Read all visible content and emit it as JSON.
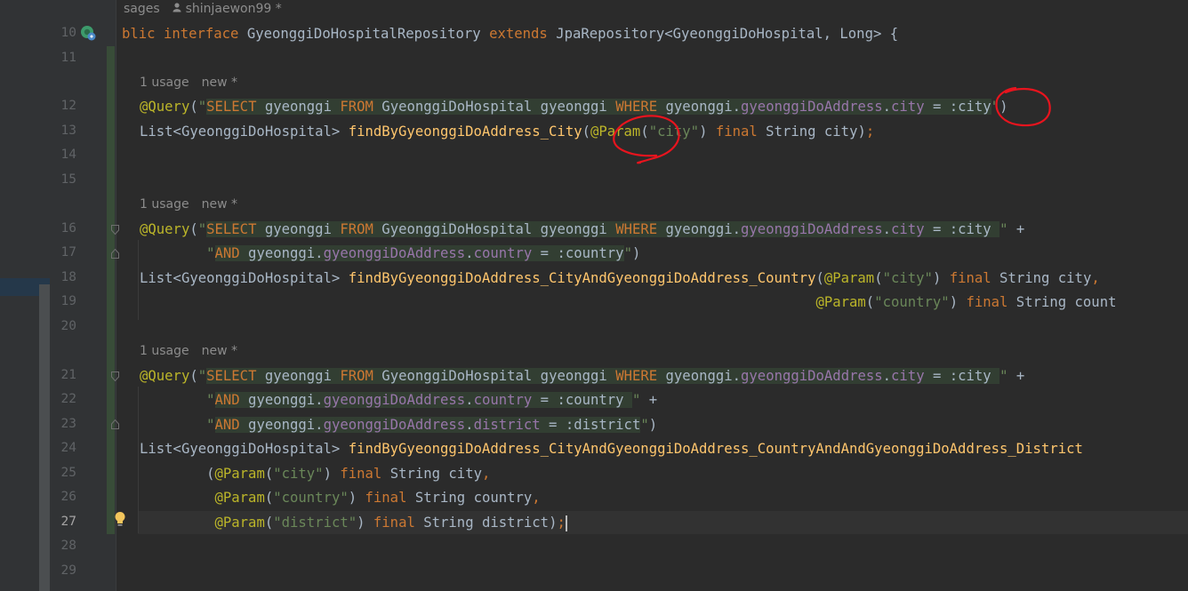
{
  "editor": {
    "top_hint": {
      "usages": "sages",
      "author": "shinjaewon99 *"
    },
    "current_line": "27",
    "line_numbers": [
      "10",
      "11",
      "12",
      "13",
      "14",
      "15",
      "16",
      "17",
      "18",
      "19",
      "20",
      "21",
      "22",
      "23",
      "24",
      "25",
      "26",
      "27",
      "28",
      "29"
    ],
    "usage_hints": [
      {
        "usage": "1 usage",
        "status": "new *"
      },
      {
        "usage": "1 usage",
        "status": "new *"
      },
      {
        "usage": "1 usage",
        "status": "new *"
      }
    ],
    "code": {
      "l10": {
        "kw1": "blic interface ",
        "name": "GyeonggiDoHospitalRepository ",
        "kw2": "extends ",
        "rest": "JpaRepository<GyeonggiDoHospital, Long> {"
      },
      "l12": {
        "ann": "@Query",
        "open": "(",
        "q": "\"",
        "sel": "SELECT",
        "t1": " gyeonggi ",
        "from": "FROM",
        "t2": " GyeonggiDoHospital gyeonggi ",
        "where": "WHERE",
        "t3": " gyeonggi.",
        "fld": "gyeonggiDoAddress",
        "dot": ".",
        "fld2": "city",
        "t4": " = :city",
        "q2": "\"",
        "close": ")"
      },
      "l13": {
        "t1": "List<GyeonggiDoHospital> ",
        "method": "findByGyeonggiDoAddress_City",
        "p1": "(",
        "ann": "@Param",
        "p2": "(",
        "str": "\"city\"",
        "p3": ") ",
        "kw": "final",
        "t2": " String city)",
        "semi": ";"
      },
      "l16": {
        "ann": "@Query",
        "open": "(",
        "q": "\"",
        "sel": "SELECT",
        "t1": " gyeonggi ",
        "from": "FROM",
        "t2": " GyeonggiDoHospital gyeonggi ",
        "where": "WHERE",
        "t3": " gyeonggi.",
        "fld": "gyeonggiDoAddress",
        "dot": ".",
        "fld2": "city",
        "t4": " = :city ",
        "q2": "\"",
        "plus": " +"
      },
      "l17": {
        "indent": "        ",
        "q": "\"",
        "and": "AND",
        "t1": " gyeonggi.",
        "fld": "gyeonggiDoAddress",
        "dot": ".",
        "fld2": "country",
        "t2": " = :country",
        "q2": "\"",
        "close": ")"
      },
      "l18": {
        "t1": "List<GyeonggiDoHospital> ",
        "method": "findByGyeonggiDoAddress_CityAndGyeonggiDoAddress_Country",
        "p1": "(",
        "ann": "@Param",
        "p2": "(",
        "str": "\"city\"",
        "p3": ") ",
        "kw": "final",
        "t2": " String city",
        "comma": ","
      },
      "l19": {
        "indent": "                                                                                 ",
        "ann": "@Param",
        "p2": "(",
        "str": "\"country\"",
        "p3": ") ",
        "kw": "final",
        "t2": " String count"
      },
      "l21": {
        "ann": "@Query",
        "open": "(",
        "q": "\"",
        "sel": "SELECT",
        "t1": " gyeonggi ",
        "from": "FROM",
        "t2": " GyeonggiDoHospital gyeonggi ",
        "where": "WHERE",
        "t3": " gyeonggi.",
        "fld": "gyeonggiDoAddress",
        "dot": ".",
        "fld2": "city",
        "t4": " = :city ",
        "q2": "\"",
        "plus": " +"
      },
      "l22": {
        "indent": "        ",
        "q": "\"",
        "and": "AND",
        "t1": " gyeonggi.",
        "fld": "gyeonggiDoAddress",
        "dot": ".",
        "fld2": "country",
        "t2": " = :country ",
        "q2": "\"",
        "plus": " +"
      },
      "l23": {
        "indent": "        ",
        "q": "\"",
        "and": "AND",
        "t1": " gyeonggi.",
        "fld": "gyeonggiDoAddress",
        "dot": ".",
        "fld2": "district",
        "t2": " = :district",
        "q2": "\"",
        "close": ")"
      },
      "l24": {
        "t1": "List<GyeonggiDoHospital> ",
        "method": "findByGyeonggiDoAddress_CityAndGyeonggiDoAddress_CountryAndAndGyeonggiDoAddress_District"
      },
      "l25": {
        "indent": "        ",
        "p1": "(",
        "ann": "@Param",
        "p2": "(",
        "str": "\"city\"",
        "p3": ") ",
        "kw": "final",
        "t2": " String city",
        "comma": ","
      },
      "l26": {
        "indent": "         ",
        "ann": "@Param",
        "p2": "(",
        "str": "\"country\"",
        "p3": ") ",
        "kw": "final",
        "t2": " String country",
        "comma": ","
      },
      "l27": {
        "indent": "         ",
        "ann": "@Param",
        "p2": "(",
        "str": "\"district\"",
        "p3": ") ",
        "kw": "final",
        "t2": " String district)",
        "semi": ";"
      }
    },
    "colors": {
      "background": "#2b2b2b",
      "keyword": "#cc7832",
      "annotation": "#bbb529",
      "string": "#6a8759",
      "method": "#ffc66d",
      "field": "#9876aa",
      "annotation_marks": "#e8141e"
    }
  }
}
